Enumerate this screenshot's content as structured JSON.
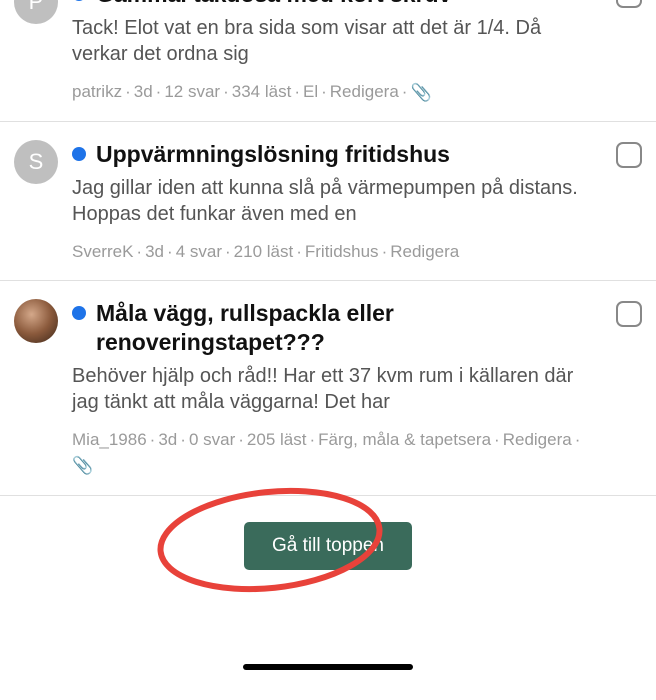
{
  "threads": [
    {
      "avatar_initial": "P",
      "avatar_type": "letter",
      "title": "Gammal takdosa med kort skruv",
      "snippet": "Tack! Elot vat en bra sida som visar att det är 1/4. Då verkar det ordna sig",
      "author": "patrikz",
      "age": "3d",
      "replies": "12 svar",
      "views": "334 läst",
      "category": "El",
      "edit_label": "Redigera",
      "has_attachment": true
    },
    {
      "avatar_initial": "S",
      "avatar_type": "letter",
      "title": "Uppvärmningslösning fritidshus",
      "snippet": "Jag gillar iden att kunna slå på värmepumpen på distans. Hoppas det funkar även med en",
      "author": "SverreK",
      "age": "3d",
      "replies": "4 svar",
      "views": "210 läst",
      "category": "Fritidshus",
      "edit_label": "Redigera",
      "has_attachment": false
    },
    {
      "avatar_initial": "",
      "avatar_type": "photo",
      "title": "Måla vägg, rullspackla eller renoveringstapet???",
      "snippet": "Behöver hjälp och råd!! Har ett 37 kvm rum i källaren där jag tänkt att måla väggarna! Det har",
      "author": "Mia_1986",
      "age": "3d",
      "replies": "0 svar",
      "views": "205 läst",
      "category": "Färg, måla & tapetsera",
      "edit_label": "Redigera",
      "has_attachment": true
    }
  ],
  "footer": {
    "go_top_label": "Gå till toppen"
  },
  "icons": {
    "paperclip": "📎"
  }
}
